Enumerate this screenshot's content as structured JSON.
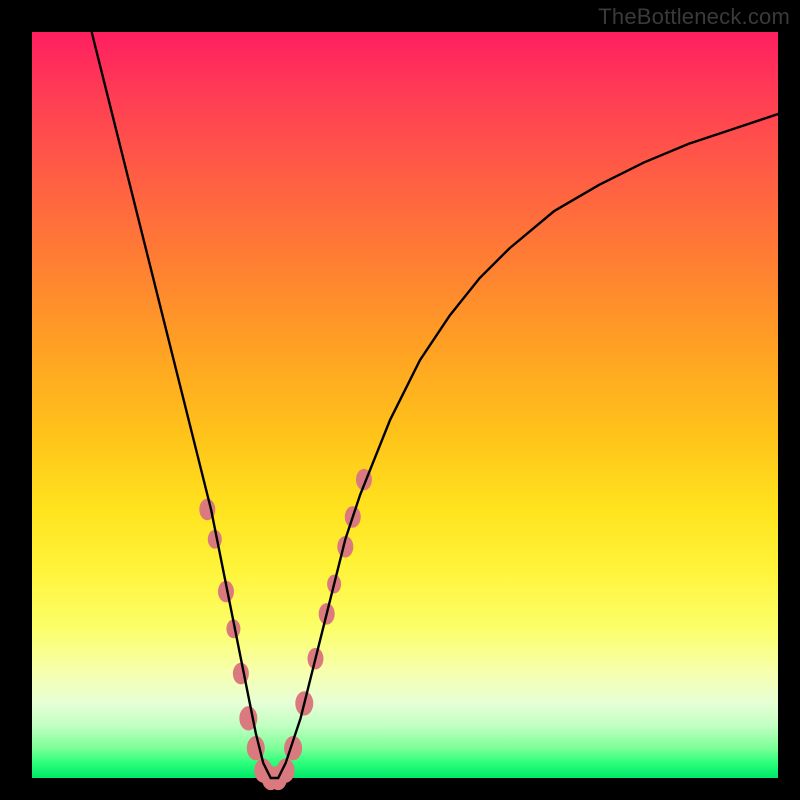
{
  "watermark": "TheBottleneck.com",
  "chart_data": {
    "type": "line",
    "title": "",
    "xlabel": "",
    "ylabel": "",
    "xlim": [
      0,
      100
    ],
    "ylim": [
      0,
      100
    ],
    "series": [
      {
        "name": "bottleneck-curve",
        "x": [
          8,
          10,
          12,
          14,
          16,
          18,
          20,
          22,
          24,
          26,
          28,
          30,
          31,
          32,
          33,
          34,
          36,
          38,
          40,
          42,
          44,
          48,
          52,
          56,
          60,
          64,
          70,
          76,
          82,
          88,
          94,
          100
        ],
        "y": [
          100,
          92,
          84,
          76,
          68,
          60,
          52,
          44,
          36,
          26,
          16,
          6,
          2,
          0,
          0,
          2,
          8,
          16,
          24,
          32,
          38,
          48,
          56,
          62,
          67,
          71,
          76,
          79.5,
          82.5,
          85,
          87,
          89
        ]
      }
    ],
    "markers": {
      "name": "pink-lobes",
      "points": [
        {
          "x": 23.5,
          "y": 36,
          "r": 8
        },
        {
          "x": 24.5,
          "y": 32,
          "r": 7
        },
        {
          "x": 26.0,
          "y": 25,
          "r": 8
        },
        {
          "x": 27.0,
          "y": 20,
          "r": 7
        },
        {
          "x": 28.0,
          "y": 14,
          "r": 8
        },
        {
          "x": 29.0,
          "y": 8,
          "r": 9
        },
        {
          "x": 30.0,
          "y": 4,
          "r": 9
        },
        {
          "x": 31.0,
          "y": 1,
          "r": 9
        },
        {
          "x": 32.0,
          "y": 0,
          "r": 9
        },
        {
          "x": 33.0,
          "y": 0,
          "r": 9
        },
        {
          "x": 34.0,
          "y": 1,
          "r": 9
        },
        {
          "x": 35.0,
          "y": 4,
          "r": 9
        },
        {
          "x": 36.5,
          "y": 10,
          "r": 9
        },
        {
          "x": 38.0,
          "y": 16,
          "r": 8
        },
        {
          "x": 39.5,
          "y": 22,
          "r": 8
        },
        {
          "x": 40.5,
          "y": 26,
          "r": 7
        },
        {
          "x": 42.0,
          "y": 31,
          "r": 8
        },
        {
          "x": 43.0,
          "y": 35,
          "r": 8
        },
        {
          "x": 44.5,
          "y": 40,
          "r": 8
        }
      ]
    },
    "background_gradient": {
      "top": "#ff1f60",
      "mid1": "#ffa024",
      "mid2": "#fff43a",
      "bottom": "#00e76b"
    }
  }
}
